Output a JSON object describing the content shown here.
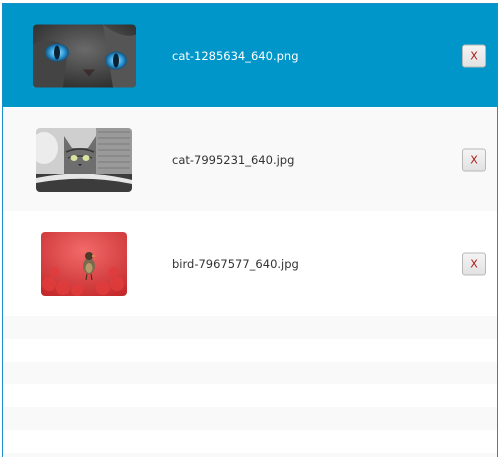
{
  "file_list": {
    "items": [
      {
        "filename": "cat-1285634_640.png",
        "remove_label": "X",
        "selected": true
      },
      {
        "filename": "cat-7995231_640.jpg",
        "remove_label": "X",
        "selected": false
      },
      {
        "filename": "bird-7967577_640.jpg",
        "remove_label": "X",
        "selected": false
      }
    ]
  },
  "colors": {
    "selection": "#0096c9",
    "border": "#1a8fcb",
    "stripe": "#f9f9f9",
    "remove_glyph": "#b01818"
  }
}
